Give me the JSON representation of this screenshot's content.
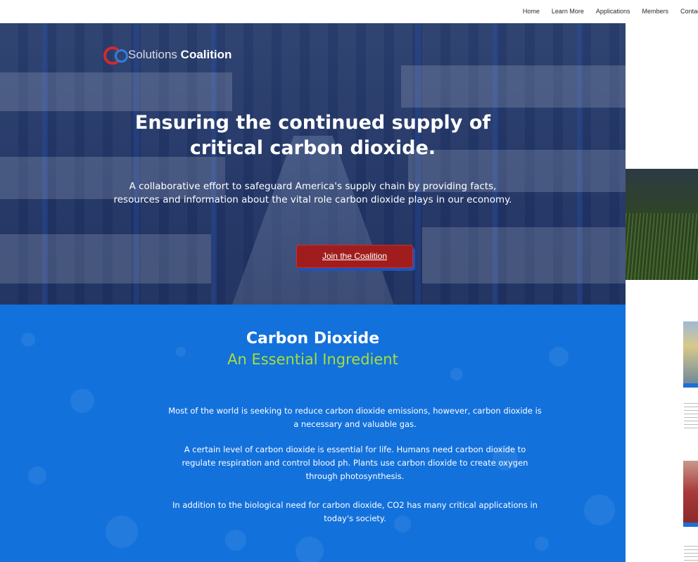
{
  "nav": {
    "items": [
      {
        "label": "Home"
      },
      {
        "label": "Learn More"
      },
      {
        "label": "Applications"
      },
      {
        "label": "Members"
      },
      {
        "label": "Contact"
      }
    ]
  },
  "logo": {
    "mark": "CO2",
    "word1": "Solutions",
    "word2": "Coalition"
  },
  "hero": {
    "title_line1": "Ensuring the continued supply of",
    "title_line2": "critical carbon dioxide.",
    "subtitle_line1": "A collaborative effort to safeguard America's supply chain by providing facts,",
    "subtitle_line2": "resources and information about the vital role carbon dioxide plays in our economy.",
    "cta_label": "Join the Coalition"
  },
  "essential": {
    "title": "Carbon Dioxide",
    "subtitle": "An Essential Ingredient",
    "paragraphs": [
      {
        "line1": "Most of the world is seeking to reduce carbon dioxide emissions, however, carbon dioxide is",
        "line2": "a necessary and valuable gas."
      },
      {
        "line1": "A certain level of carbon dioxide is essential for life. Humans need carbon dioxide to",
        "line2": "regulate respiration and control blood ph. Plants use carbon dioxide to create oxygen",
        "line3": "through photosynthesis."
      },
      {
        "line1": "In addition to the biological need for carbon dioxide, CO2 has many critical applications in",
        "line2": "today's society."
      }
    ]
  },
  "colors": {
    "brand_red": "#a11d1d",
    "brand_blue": "#1371dc",
    "accent_green": "#a8de3a"
  }
}
